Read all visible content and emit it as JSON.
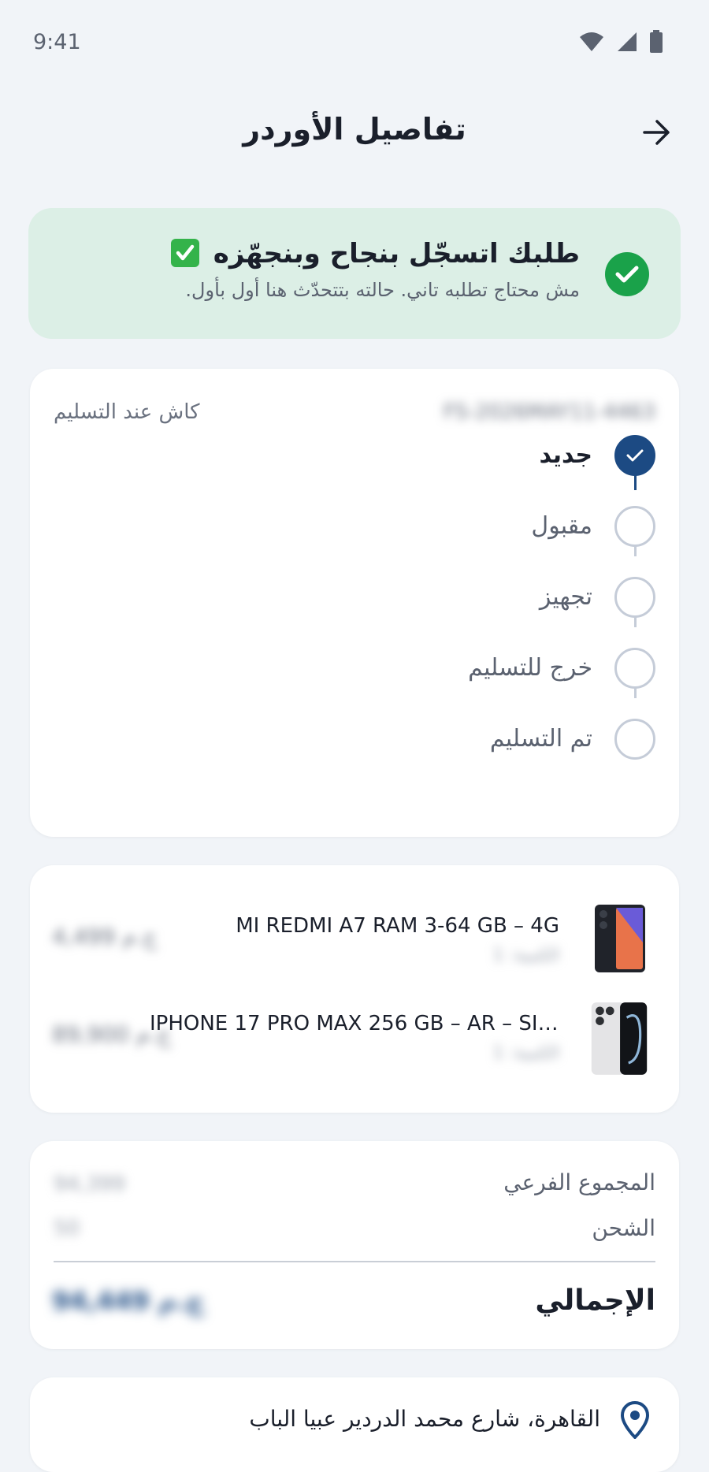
{
  "status_bar": {
    "time": "9:41"
  },
  "header": {
    "title": "تفاصيل الأوردر"
  },
  "banner": {
    "title": "طلبك اتسجّل بنجاح وبنجهّزه",
    "subtitle": "مش محتاج تطلبه تاني. حالته بتتحدّث هنا أول بأول."
  },
  "order": {
    "payment_method": "كاش عند التسليم",
    "order_id": "FS-2026MAY11-4463",
    "statuses": [
      {
        "label": "جديد",
        "done": true
      },
      {
        "label": "مقبول",
        "done": false
      },
      {
        "label": "تجهيز",
        "done": false
      },
      {
        "label": "خرج للتسليم",
        "done": false
      },
      {
        "label": "تم التسليم",
        "done": false
      }
    ]
  },
  "products": [
    {
      "name": "MI REDMI A7 RAM 3-64 GB – 4G",
      "meta": "الكمية: 1",
      "price": "4,499 ج.م"
    },
    {
      "name": "IPHONE 17 PRO MAX 256 GB – AR – SIL...",
      "meta": "الكمية: 1",
      "price": "89,900 ج.م"
    }
  ],
  "totals": {
    "subtotal_label": "المجموع الفرعي",
    "subtotal_value": "94,399",
    "shipping_label": "الشحن",
    "shipping_value": "50",
    "total_label": "الإجمالي",
    "total_value": "94,449 ج.م"
  },
  "address": {
    "text": "القاهرة، شارع محمد الدردير عبيا الباب"
  },
  "colors": {
    "primary": "#1c4a83",
    "success": "#1aa24a",
    "banner_bg": "#dcefe6"
  }
}
